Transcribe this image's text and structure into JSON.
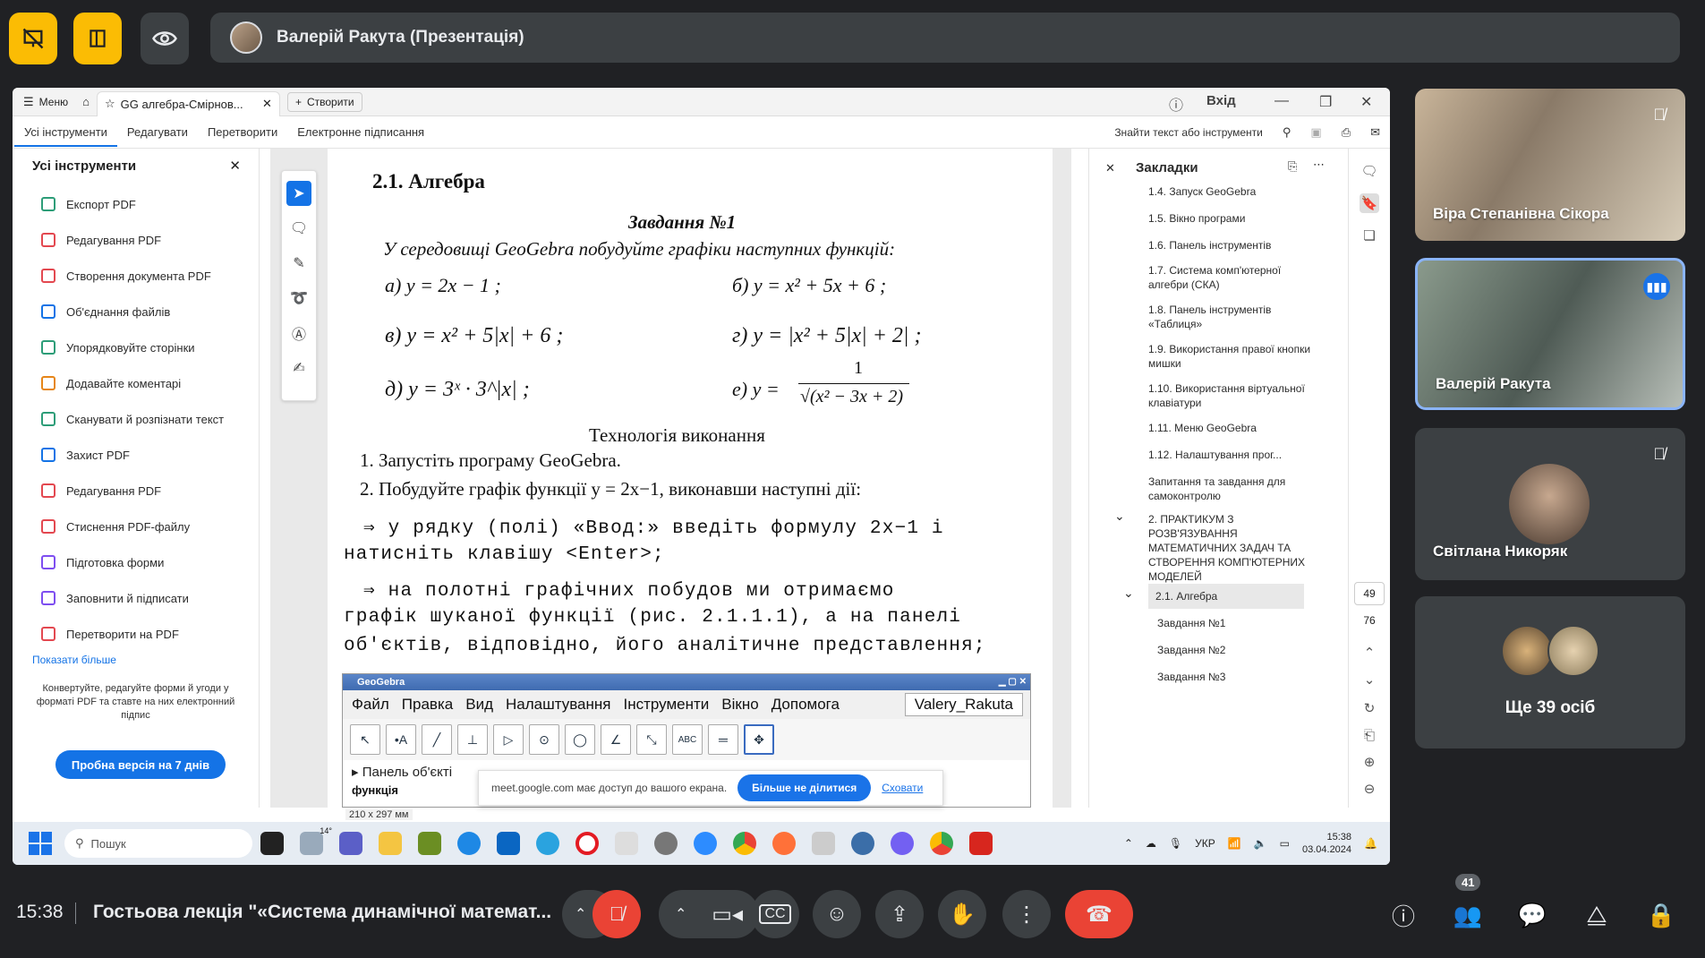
{
  "meet": {
    "presenter_title": "Валерій Ракута (Презентація)",
    "time": "15:38",
    "meeting_title": "Гостьова лекція \"«Система динамічної математ...",
    "participants_badge": "41",
    "colors": {
      "accent_yellow": "#fbbc04",
      "end_call": "#ea4335",
      "mic_off": "#ea4335",
      "bg": "#202124"
    }
  },
  "tiles": [
    {
      "name": "Віра Степанівна Сікора",
      "muted": true
    },
    {
      "name": "Валерій Ракута",
      "speaking": true
    },
    {
      "name": "Світлана Никоряк",
      "muted": true
    },
    {
      "name": "Ще 39 осіб"
    }
  ],
  "acrobat": {
    "menu": "Меню",
    "tab_title": "GG алгебра-Смірнов...",
    "create": "Створити",
    "login": "Вхід",
    "menubar": [
      "Усі інструменти",
      "Редагувати",
      "Перетворити",
      "Електронне підписання"
    ],
    "search": "Знайти текст або інструменти",
    "left_title": "Усі інструменти",
    "left_items": [
      "Експорт PDF",
      "Редагування PDF",
      "Створення документа PDF",
      "Об'єднання файлів",
      "Упорядковуйте сторінки",
      "Додавайте коментарі",
      "Сканувати й розпізнати текст",
      "Захист PDF",
      "Редагування PDF",
      "Стиснення PDF-файлу",
      "Підготовка форми",
      "Заповнити й підписати",
      "Перетворити на PDF"
    ],
    "show_more": "Показати більше",
    "promo": "Конвертуйте, редагуйте форми й угоди у форматі PDF та ставте на них електронний підпис",
    "trial": "Пробна версія на 7 днів",
    "page_size": "210 x 297 мм",
    "bookmarks_title": "Закладки",
    "bookmarks": [
      "1.4. Запуск GeoGebra",
      "1.5. Вікно програми",
      "1.6. Панель інструментів",
      "1.7. Система комп'ютерної алгебри (СКА)",
      "1.8. Панель інструментів «Таблиця»",
      "1.9. Використання правої кнопки мишки",
      "1.10. Використання віртуальної клавіатури",
      "1.11. Меню GeoGebra",
      "1.12. Налаштування прог...",
      "Запитання та завдання для самоконтролю",
      "2. ПРАКТИКУМ З РОЗВ'ЯЗУВАННЯ МАТЕМАТИЧНИХ ЗАДАЧ ТА СТВОРЕННЯ КОМП'ЮТЕРНИХ МОДЕЛЕЙ",
      "2.1. Алгебра",
      "Завдання №1",
      "Завдання №2",
      "Завдання №3"
    ],
    "page_num": "49",
    "page_total": "76"
  },
  "doc": {
    "heading": "2.1.  Алгебра",
    "task": "Завдання №1",
    "intro": "У середовищі GeoGebra побудуйте графіки наступних функцій:",
    "fa": "а)  y = 2x − 1 ;",
    "fb": "б)  y = x² + 5x + 6 ;",
    "fv": "в)  y = x² + 5|x| + 6 ;",
    "fg": "г)  y = |x² + 5|x| + 2| ;",
    "fd": "д)  y = 3ˣ · 3^|x| ;",
    "fe_lhs": "е)  y =",
    "fe_num": "1",
    "fe_den": "√(x² − 3x + 2)",
    "tech": "Технологія виконання",
    "step1": "1.   Запустіть програму GeoGebra.",
    "step2": "2.   Побудуйте графік функції  y = 2x−1, виконавши наступні дії:",
    "arrow1a": "⇒    у рядку (полі) «Ввод:» введіть формулу  2x−1  і",
    "arrow1b": "натисніть клавішу <Enter>;",
    "arrow2a": "⇒     на  полотні  графічних  побудов  ми  отримаємо",
    "arrow2b": "графік  шуканої  функції  (рис.  2.1.1.1),  а  на  панелі",
    "arrow2c": "об'єктів,  відповідно,  його  аналітичне  представлення;",
    "gg_title": "GeoGebra",
    "gg_menu": [
      "Файл",
      "Правка",
      "Вид",
      "Налаштування",
      "Інструменти",
      "Вікно",
      "Допомога"
    ],
    "gg_user": "Valery_Rakuta",
    "gg_panel": "Панель об'єкті",
    "gg_func": "функція"
  },
  "sharebar": {
    "text": "meet.google.com має доступ до вашого екрана.",
    "stop": "Більше не ділитися",
    "hide": "Сховати"
  },
  "taskbar": {
    "search": "Пошук",
    "weather": "14°",
    "lang": "УКР",
    "time": "15:38",
    "date": "03.04.2024"
  }
}
